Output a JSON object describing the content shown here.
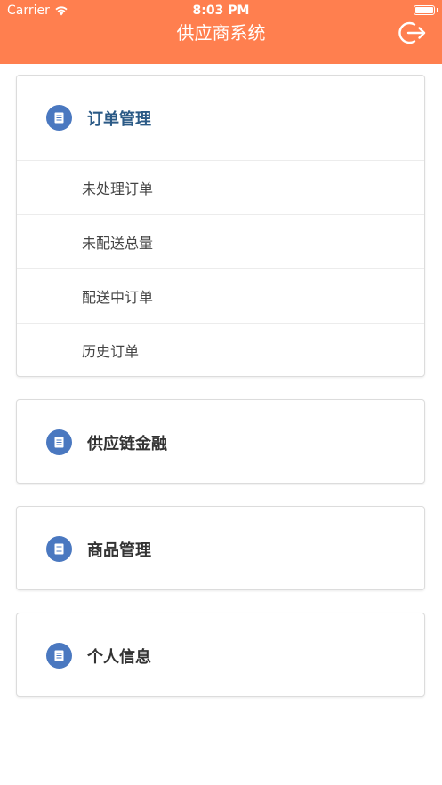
{
  "status_bar": {
    "carrier": "Carrier",
    "time": "8:03 PM"
  },
  "nav": {
    "title": "供应商系统",
    "logout_icon": "logout-icon"
  },
  "menu": [
    {
      "title": "订单管理",
      "expanded": true,
      "icon": "document-icon",
      "items": [
        {
          "label": "未处理订单"
        },
        {
          "label": "未配送总量"
        },
        {
          "label": "配送中订单"
        },
        {
          "label": "历史订单"
        }
      ]
    },
    {
      "title": "供应链金融",
      "expanded": false,
      "icon": "document-icon",
      "items": []
    },
    {
      "title": "商品管理",
      "expanded": false,
      "icon": "document-icon",
      "items": []
    },
    {
      "title": "个人信息",
      "expanded": false,
      "icon": "document-icon",
      "items": []
    }
  ],
  "colors": {
    "header_bg": "#FF7F4F",
    "icon_bg": "#4A78C0",
    "active_title": "#2B5A86"
  }
}
